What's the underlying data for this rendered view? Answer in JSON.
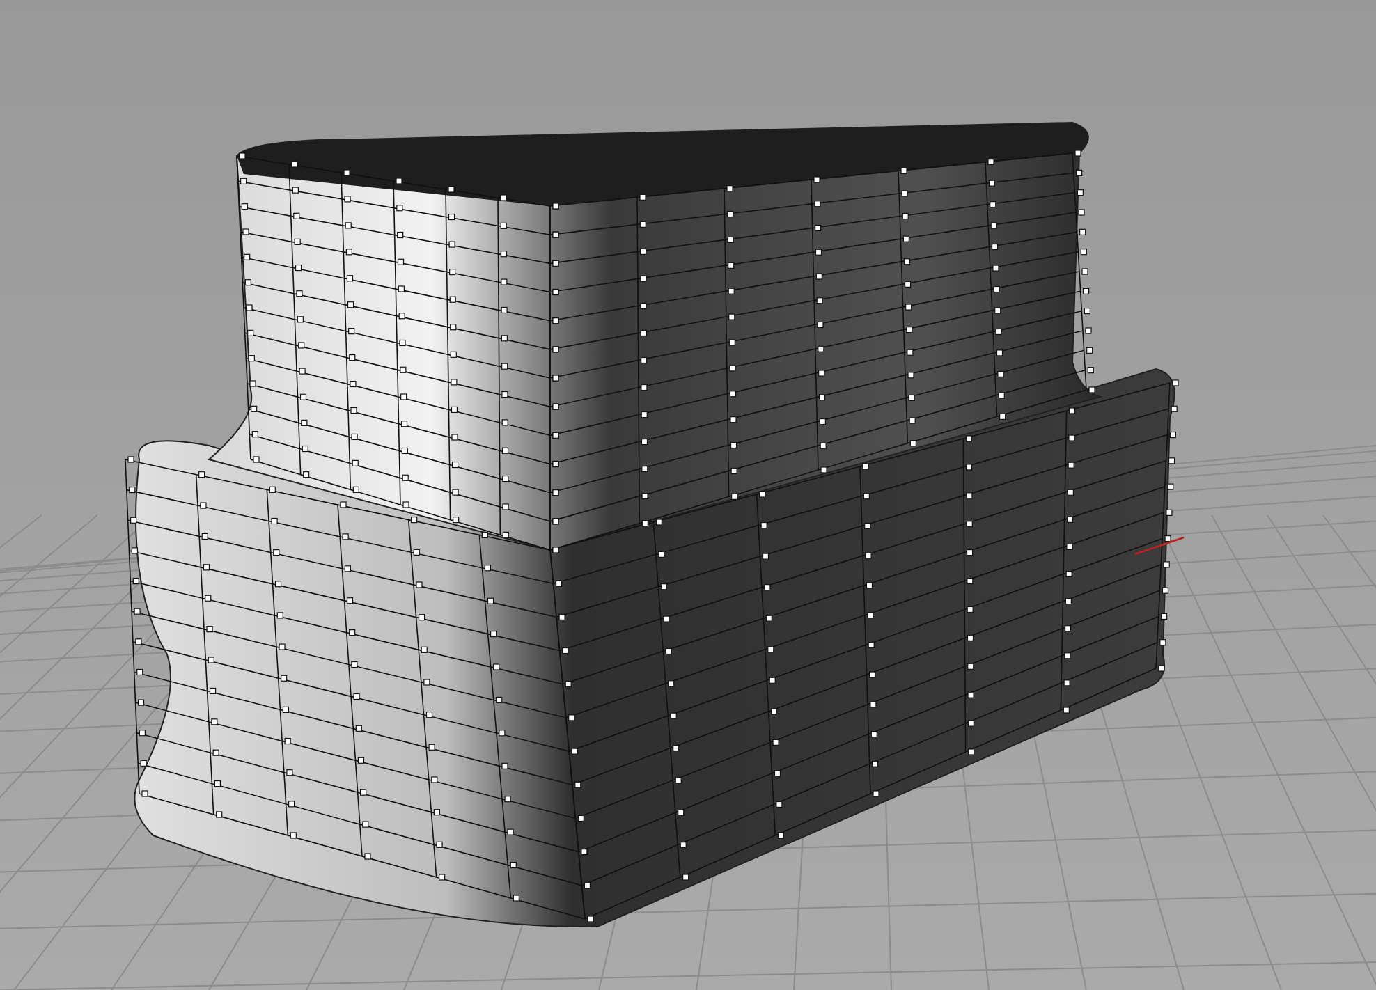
{
  "viewport": {
    "show_grid": true,
    "show_control_points": true
  }
}
